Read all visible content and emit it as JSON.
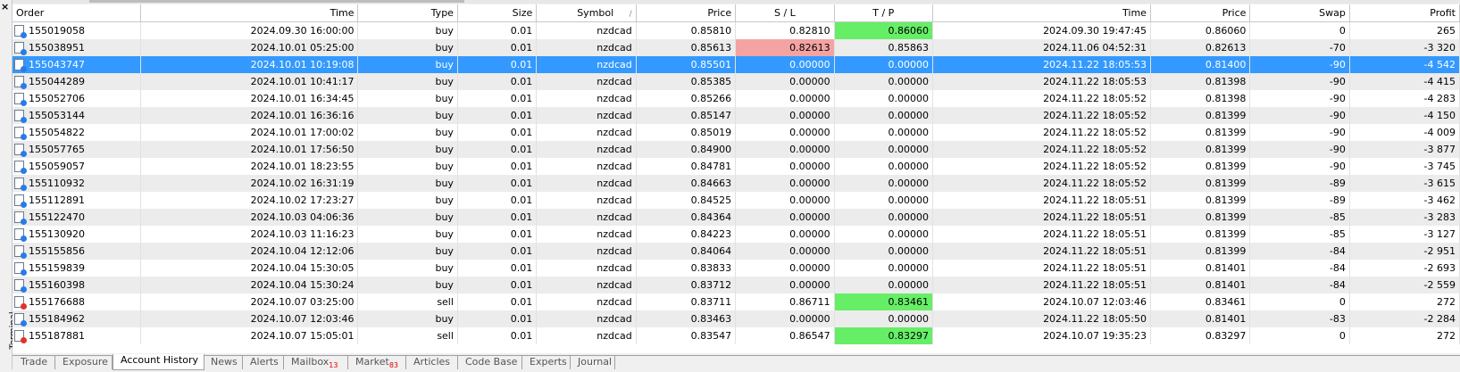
{
  "panel": {
    "label": "Terminal",
    "close": "×"
  },
  "columns": [
    "Order",
    "Time",
    "Type",
    "Size",
    "Symbol",
    "Price",
    "S / L",
    "T / P",
    "Time",
    "Price",
    "Swap",
    "Profit"
  ],
  "sort_marker": "/",
  "rows": [
    {
      "order": "155019058",
      "time": "2024.09.30 16:00:00",
      "type": "buy",
      "size": "0.01",
      "symbol": "nzdcad",
      "price": "0.85810",
      "sl": "0.82810",
      "tp": "0.86060",
      "close_time": "2024.09.30 19:47:45",
      "close_price": "0.86060",
      "swap": "0",
      "profit": "265",
      "tp_hit": true
    },
    {
      "order": "155038951",
      "time": "2024.10.01 05:25:00",
      "type": "buy",
      "size": "0.01",
      "symbol": "nzdcad",
      "price": "0.85613",
      "sl": "0.82613",
      "tp": "0.85863",
      "close_time": "2024.11.06 04:52:31",
      "close_price": "0.82613",
      "swap": "-70",
      "profit": "-3 320",
      "sl_hit": true
    },
    {
      "order": "155043747",
      "time": "2024.10.01 10:19:08",
      "type": "buy",
      "size": "0.01",
      "symbol": "nzdcad",
      "price": "0.85501",
      "sl": "0.00000",
      "tp": "0.00000",
      "close_time": "2024.11.22 18:05:53",
      "close_price": "0.81400",
      "swap": "-90",
      "profit": "-4 542",
      "selected": true
    },
    {
      "order": "155044289",
      "time": "2024.10.01 10:41:17",
      "type": "buy",
      "size": "0.01",
      "symbol": "nzdcad",
      "price": "0.85385",
      "sl": "0.00000",
      "tp": "0.00000",
      "close_time": "2024.11.22 18:05:53",
      "close_price": "0.81398",
      "swap": "-90",
      "profit": "-4 415"
    },
    {
      "order": "155052706",
      "time": "2024.10.01 16:34:45",
      "type": "buy",
      "size": "0.01",
      "symbol": "nzdcad",
      "price": "0.85266",
      "sl": "0.00000",
      "tp": "0.00000",
      "close_time": "2024.11.22 18:05:52",
      "close_price": "0.81398",
      "swap": "-90",
      "profit": "-4 283"
    },
    {
      "order": "155053144",
      "time": "2024.10.01 16:36:16",
      "type": "buy",
      "size": "0.01",
      "symbol": "nzdcad",
      "price": "0.85147",
      "sl": "0.00000",
      "tp": "0.00000",
      "close_time": "2024.11.22 18:05:52",
      "close_price": "0.81399",
      "swap": "-90",
      "profit": "-4 150"
    },
    {
      "order": "155054822",
      "time": "2024.10.01 17:00:02",
      "type": "buy",
      "size": "0.01",
      "symbol": "nzdcad",
      "price": "0.85019",
      "sl": "0.00000",
      "tp": "0.00000",
      "close_time": "2024.11.22 18:05:52",
      "close_price": "0.81399",
      "swap": "-90",
      "profit": "-4 009"
    },
    {
      "order": "155057765",
      "time": "2024.10.01 17:56:50",
      "type": "buy",
      "size": "0.01",
      "symbol": "nzdcad",
      "price": "0.84900",
      "sl": "0.00000",
      "tp": "0.00000",
      "close_time": "2024.11.22 18:05:52",
      "close_price": "0.81399",
      "swap": "-90",
      "profit": "-3 877"
    },
    {
      "order": "155059057",
      "time": "2024.10.01 18:23:55",
      "type": "buy",
      "size": "0.01",
      "symbol": "nzdcad",
      "price": "0.84781",
      "sl": "0.00000",
      "tp": "0.00000",
      "close_time": "2024.11.22 18:05:52",
      "close_price": "0.81399",
      "swap": "-90",
      "profit": "-3 745"
    },
    {
      "order": "155110932",
      "time": "2024.10.02 16:31:19",
      "type": "buy",
      "size": "0.01",
      "symbol": "nzdcad",
      "price": "0.84663",
      "sl": "0.00000",
      "tp": "0.00000",
      "close_time": "2024.11.22 18:05:52",
      "close_price": "0.81399",
      "swap": "-89",
      "profit": "-3 615"
    },
    {
      "order": "155112891",
      "time": "2024.10.02 17:23:27",
      "type": "buy",
      "size": "0.01",
      "symbol": "nzdcad",
      "price": "0.84525",
      "sl": "0.00000",
      "tp": "0.00000",
      "close_time": "2024.11.22 18:05:51",
      "close_price": "0.81399",
      "swap": "-89",
      "profit": "-3 462"
    },
    {
      "order": "155122470",
      "time": "2024.10.03 04:06:36",
      "type": "buy",
      "size": "0.01",
      "symbol": "nzdcad",
      "price": "0.84364",
      "sl": "0.00000",
      "tp": "0.00000",
      "close_time": "2024.11.22 18:05:51",
      "close_price": "0.81399",
      "swap": "-85",
      "profit": "-3 283"
    },
    {
      "order": "155130920",
      "time": "2024.10.03 11:16:23",
      "type": "buy",
      "size": "0.01",
      "symbol": "nzdcad",
      "price": "0.84223",
      "sl": "0.00000",
      "tp": "0.00000",
      "close_time": "2024.11.22 18:05:51",
      "close_price": "0.81399",
      "swap": "-85",
      "profit": "-3 127"
    },
    {
      "order": "155155856",
      "time": "2024.10.04 12:12:06",
      "type": "buy",
      "size": "0.01",
      "symbol": "nzdcad",
      "price": "0.84064",
      "sl": "0.00000",
      "tp": "0.00000",
      "close_time": "2024.11.22 18:05:51",
      "close_price": "0.81399",
      "swap": "-84",
      "profit": "-2 951"
    },
    {
      "order": "155159839",
      "time": "2024.10.04 15:30:05",
      "type": "buy",
      "size": "0.01",
      "symbol": "nzdcad",
      "price": "0.83833",
      "sl": "0.00000",
      "tp": "0.00000",
      "close_time": "2024.11.22 18:05:51",
      "close_price": "0.81401",
      "swap": "-84",
      "profit": "-2 693"
    },
    {
      "order": "155160398",
      "time": "2024.10.04 15:30:24",
      "type": "buy",
      "size": "0.01",
      "symbol": "nzdcad",
      "price": "0.83712",
      "sl": "0.00000",
      "tp": "0.00000",
      "close_time": "2024.11.22 18:05:51",
      "close_price": "0.81401",
      "swap": "-84",
      "profit": "-2 559"
    },
    {
      "order": "155176688",
      "time": "2024.10.07 03:25:00",
      "type": "sell",
      "size": "0.01",
      "symbol": "nzdcad",
      "price": "0.83711",
      "sl": "0.86711",
      "tp": "0.83461",
      "close_time": "2024.10.07 12:03:46",
      "close_price": "0.83461",
      "swap": "0",
      "profit": "272",
      "tp_hit": true
    },
    {
      "order": "155184962",
      "time": "2024.10.07 12:03:46",
      "type": "buy",
      "size": "0.01",
      "symbol": "nzdcad",
      "price": "0.83463",
      "sl": "0.00000",
      "tp": "0.00000",
      "close_time": "2024.11.22 18:05:50",
      "close_price": "0.81401",
      "swap": "-83",
      "profit": "-2 284"
    },
    {
      "order": "155187881",
      "time": "2024.10.07 15:05:01",
      "type": "sell",
      "size": "0.01",
      "symbol": "nzdcad",
      "price": "0.83547",
      "sl": "0.86547",
      "tp": "0.83297",
      "close_time": "2024.10.07 19:35:23",
      "close_price": "0.83297",
      "swap": "0",
      "profit": "272",
      "tp_hit": true
    }
  ],
  "tabs": [
    {
      "label": "Trade"
    },
    {
      "label": "Exposure"
    },
    {
      "label": "Account History",
      "active": true
    },
    {
      "label": "News"
    },
    {
      "label": "Alerts"
    },
    {
      "label": "Mailbox",
      "badge": "13"
    },
    {
      "label": "Market",
      "badge": "83"
    },
    {
      "label": "Articles"
    },
    {
      "label": "Code Base"
    },
    {
      "label": "Experts"
    },
    {
      "label": "Journal"
    }
  ],
  "colors": {
    "selected": "#3399ff",
    "tp_hit": "#66ee66",
    "sl_hit": "#f4a3a3",
    "alt_row": "#ececec"
  },
  "icons": {
    "buy": "order-doc-blue-icon",
    "sell": "order-doc-red-icon"
  }
}
